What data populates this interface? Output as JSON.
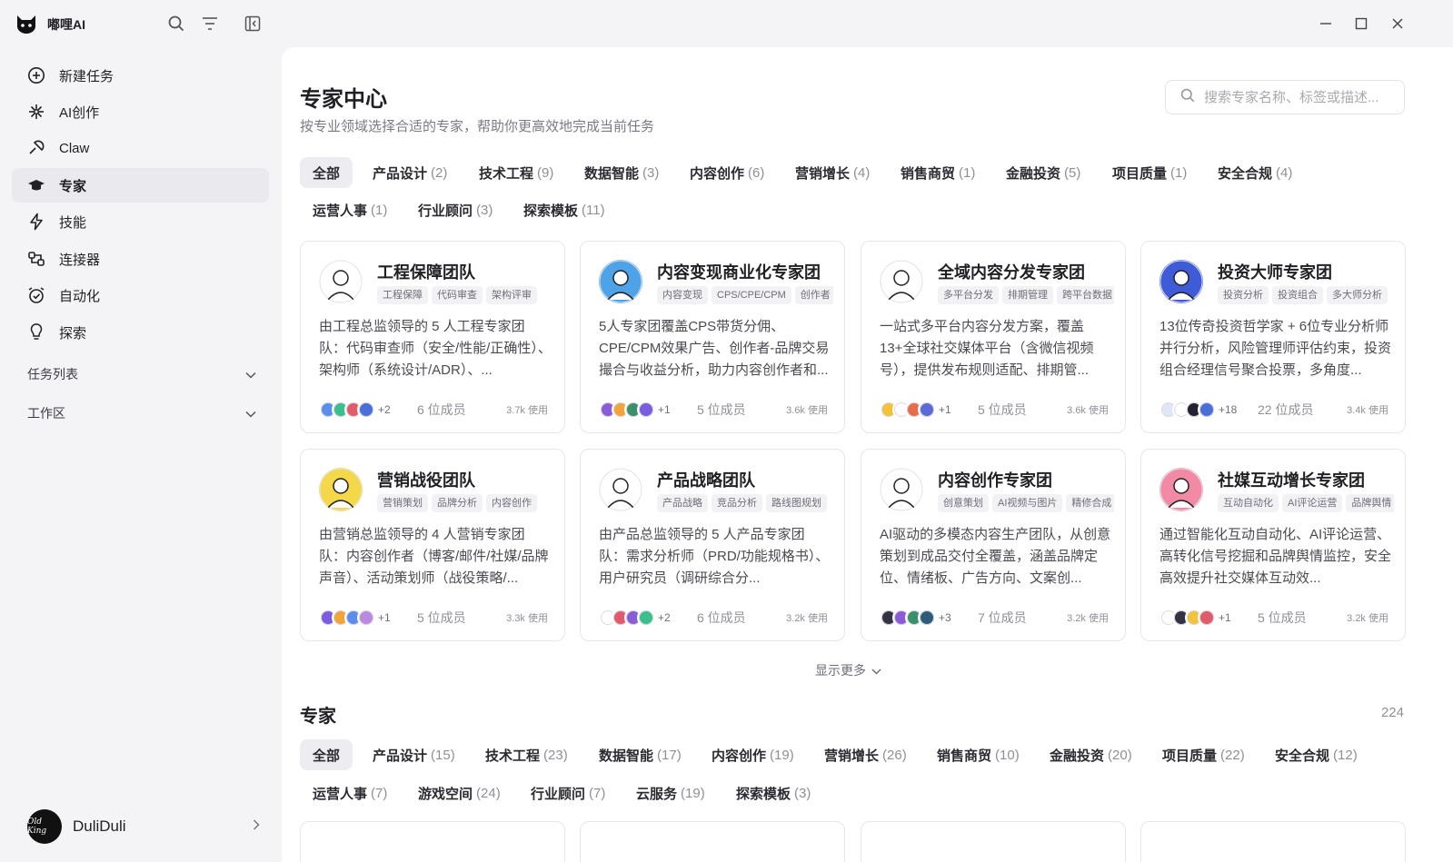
{
  "app": {
    "name": "嘟哩AI"
  },
  "sidebar": {
    "items": [
      {
        "label": "新建任务",
        "icon": "plus-circle-icon"
      },
      {
        "label": "AI创作",
        "icon": "sparkle-icon"
      },
      {
        "label": "Claw",
        "icon": "claw-icon"
      },
      {
        "label": "专家",
        "icon": "graduation-cap-icon",
        "active": true
      },
      {
        "label": "技能",
        "icon": "lightning-icon"
      },
      {
        "label": "连接器",
        "icon": "connector-icon"
      },
      {
        "label": "自动化",
        "icon": "alarm-check-icon"
      },
      {
        "label": "探索",
        "icon": "lightbulb-icon"
      }
    ],
    "sections": [
      {
        "label": "任务列表"
      },
      {
        "label": "工作区"
      }
    ],
    "user": {
      "name": "DuliDuli",
      "avatar_text": "Old King"
    }
  },
  "main": {
    "title": "专家中心",
    "subtitle": "按专业领域选择合适的专家，帮助你更高效地完成当前任务",
    "search_placeholder": "搜索专家名称、标签或描述...",
    "team_tabs": [
      {
        "label": "全部",
        "count": "",
        "active": true
      },
      {
        "label": "产品设计",
        "count": "(2)"
      },
      {
        "label": "技术工程",
        "count": "(9)"
      },
      {
        "label": "数据智能",
        "count": "(3)"
      },
      {
        "label": "内容创作",
        "count": "(6)"
      },
      {
        "label": "营销增长",
        "count": "(4)"
      },
      {
        "label": "销售商贸",
        "count": "(1)"
      },
      {
        "label": "金融投资",
        "count": "(5)"
      },
      {
        "label": "项目质量",
        "count": "(1)"
      },
      {
        "label": "安全合规",
        "count": "(4)"
      },
      {
        "label": "运营人事",
        "count": "(1)"
      },
      {
        "label": "行业顾问",
        "count": "(3)"
      },
      {
        "label": "探索模板",
        "count": "(11)"
      }
    ],
    "cards": [
      {
        "title": "工程保障团队",
        "tags": [
          "工程保障",
          "代码审查",
          "架构评审"
        ],
        "desc": "由工程总监领导的 5 人工程专家团队：代码审查师（安全/性能/正确性）、架构师（系统设计/ADR）、...",
        "plus": "+2",
        "members": "6 位成员",
        "uses": "3.7k 使用",
        "avatar_color": "#ffffff",
        "mini_colors": [
          "#5b8def",
          "#3bbf8f",
          "#e05c6c",
          "#4a6fd8"
        ]
      },
      {
        "title": "内容变现商业化专家团",
        "tags": [
          "内容变现",
          "CPS/CPE/CPM",
          "创作者"
        ],
        "desc": "5人专家团覆盖CPS带货分佣、CPE/CPM效果广告、创作者-品牌交易撮合与收益分析，助力内容创作者和...",
        "plus": "+1",
        "members": "5 位成员",
        "uses": "3.6k 使用",
        "avatar_color": "#4ea3e8",
        "mini_colors": [
          "#8c5bd8",
          "#f2a33a",
          "#3b8f6a",
          "#7a5ce0"
        ]
      },
      {
        "title": "全域内容分发专家团",
        "tags": [
          "多平台分发",
          "排期管理",
          "跨平台数据"
        ],
        "desc": "一站式多平台内容分发方案，覆盖13+全球社交媒体平台（含微信视频号），提供发布规则适配、排期管...",
        "plus": "+1",
        "members": "5 位成员",
        "uses": "3.6k 使用",
        "avatar_color": "#ffffff",
        "mini_colors": [
          "#f2c23a",
          "#ffffff",
          "#e86b4a",
          "#5b6ad8"
        ]
      },
      {
        "title": "投资大师专家团",
        "tags": [
          "投资分析",
          "投资组合",
          "多大师分析"
        ],
        "desc": "13位传奇投资哲学家 + 6位专业分析师并行分析，风险管理师评估约束，投资组合经理信号聚合投票，多角度...",
        "plus": "+18",
        "members": "22 位成员",
        "uses": "3.4k 使用",
        "avatar_color": "#3f5bd8",
        "mini_colors": [
          "#dfe6f5",
          "#ffffff",
          "#222233",
          "#4a6fd8"
        ]
      },
      {
        "title": "营销战役团队",
        "tags": [
          "营销策划",
          "品牌分析",
          "内容创作"
        ],
        "desc": "由营销总监领导的 4 人营销专家团队：内容创作者（博客/邮件/社媒/品牌声音）、活动策划师（战役策略/...",
        "plus": "+1",
        "members": "5 位成员",
        "uses": "3.3k 使用",
        "avatar_color": "#f5d84a",
        "mini_colors": [
          "#7a5ce0",
          "#f2a33a",
          "#5b8def",
          "#b98ae0"
        ]
      },
      {
        "title": "产品战略团队",
        "tags": [
          "产品战略",
          "竞品分析",
          "路线图规划"
        ],
        "desc": "由产品总监领导的 5 人产品专家团队：需求分析师（PRD/功能规格书）、用户研究员（调研综合分...",
        "plus": "+2",
        "members": "6 位成员",
        "uses": "3.2k 使用",
        "avatar_color": "#ffffff",
        "mini_colors": [
          "#ffffff",
          "#e05c6c",
          "#8c5bd8",
          "#3bbf8f"
        ]
      },
      {
        "title": "内容创作专家团",
        "tags": [
          "创意策划",
          "AI视频与图片",
          "精修合成"
        ],
        "desc": "AI驱动的多模态内容生产团队，从创意策划到成品交付全覆盖，涵盖品牌定位、情绪板、广告方向、文案创...",
        "plus": "+3",
        "members": "7 位成员",
        "uses": "3.2k 使用",
        "avatar_color": "#ffffff",
        "mini_colors": [
          "#333344",
          "#8c5bd8",
          "#3b8f6a",
          "#2f5b7a"
        ]
      },
      {
        "title": "社媒互动增长专家团",
        "tags": [
          "互动自动化",
          "AI评论运营",
          "品牌舆情"
        ],
        "desc": "通过智能化互动自动化、AI评论运营、高转化信号挖掘和品牌舆情监控，安全高效提升社交媒体互动效...",
        "plus": "+1",
        "members": "5 位成员",
        "uses": "3.2k 使用",
        "avatar_color": "#f28aa5",
        "mini_colors": [
          "#ffffff",
          "#333344",
          "#f2c23a",
          "#e05c6c"
        ]
      }
    ],
    "more_label": "显示更多",
    "experts_title": "专家",
    "experts_count": "224",
    "expert_tabs": [
      {
        "label": "全部",
        "count": "",
        "active": true
      },
      {
        "label": "产品设计",
        "count": "(15)"
      },
      {
        "label": "技术工程",
        "count": "(23)"
      },
      {
        "label": "数据智能",
        "count": "(17)"
      },
      {
        "label": "内容创作",
        "count": "(19)"
      },
      {
        "label": "营销增长",
        "count": "(26)"
      },
      {
        "label": "销售商贸",
        "count": "(10)"
      },
      {
        "label": "金融投资",
        "count": "(20)"
      },
      {
        "label": "项目质量",
        "count": "(22)"
      },
      {
        "label": "安全合规",
        "count": "(12)"
      },
      {
        "label": "运营人事",
        "count": "(7)"
      },
      {
        "label": "游戏空间",
        "count": "(24)"
      },
      {
        "label": "行业顾问",
        "count": "(7)"
      },
      {
        "label": "云服务",
        "count": "(19)"
      },
      {
        "label": "探索模板",
        "count": "(3)"
      }
    ]
  }
}
